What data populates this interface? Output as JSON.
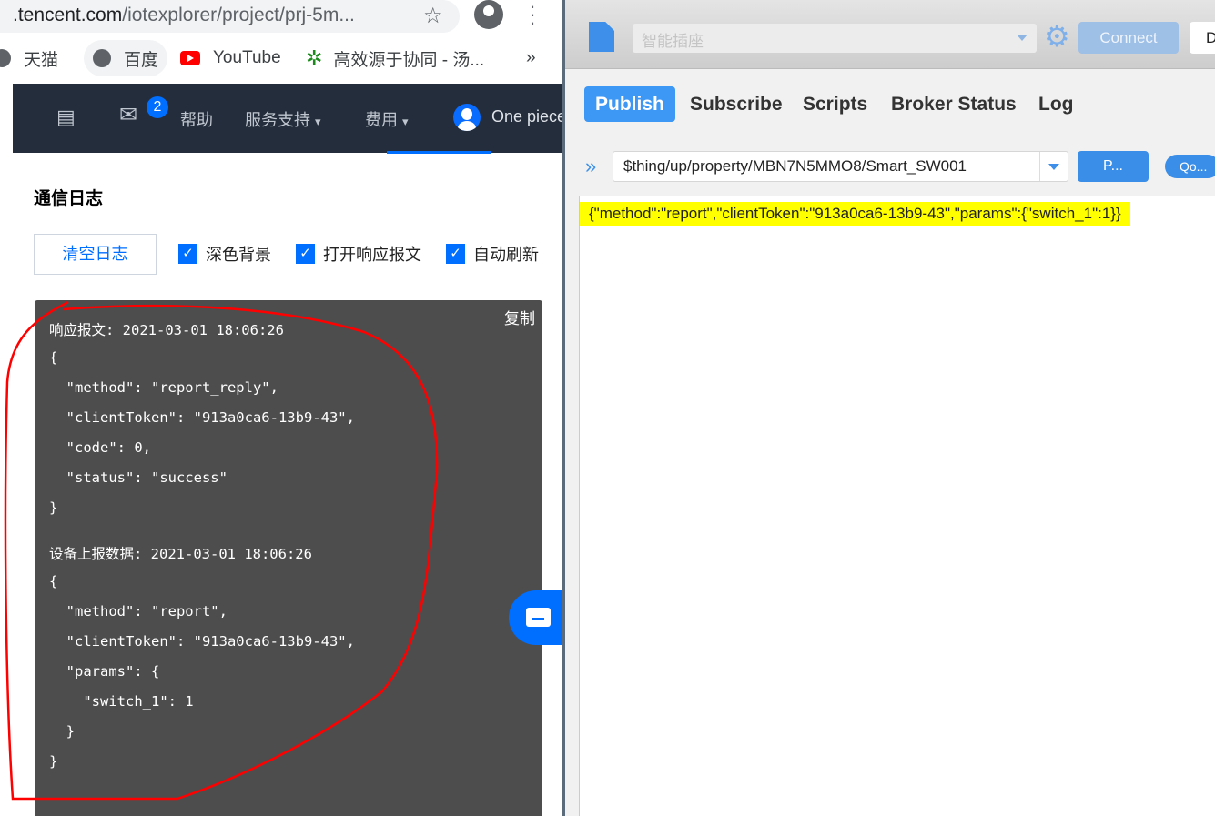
{
  "browser": {
    "url_host": ".tencent.com",
    "url_path": "/iotexplorer/project/prj-5m...",
    "bookmarks": [
      {
        "label": "天猫",
        "icon": "globe-icon"
      },
      {
        "label": "百度",
        "icon": "globe-icon"
      },
      {
        "label": "YouTube",
        "icon": "youtube-icon"
      },
      {
        "label": "高效源于协同 - 汤...",
        "icon": "gear-green-icon"
      }
    ],
    "more": "»"
  },
  "nav": {
    "badge": "2",
    "help": "帮助",
    "support": "服务支持",
    "fees": "费用",
    "user": "One piece",
    "caret": "⌄"
  },
  "log": {
    "title": "通信日志",
    "clear_button": "清空日志",
    "checkboxes": [
      {
        "label": "深色背景",
        "checked": true
      },
      {
        "label": "打开响应报文",
        "checked": true
      },
      {
        "label": "自动刷新",
        "checked": true
      }
    ],
    "copy": "复制",
    "lines": [
      "响应报文: 2021-03-01 18:06:26",
      "{",
      "  \"method\": \"report_reply\",",
      "  \"clientToken\": \"913a0ca6-13b9-43\",",
      "  \"code\": 0,",
      "  \"status\": \"success\"",
      "}",
      "设备上报数据: 2021-03-01 18:06:26",
      "{",
      "  \"method\": \"report\",",
      "  \"clientToken\": \"913a0ca6-13b9-43\",",
      "  \"params\": {",
      "    \"switch_1\": 1",
      "  }",
      "}"
    ]
  },
  "mqtt": {
    "profile": "智能插座",
    "connect": "Connect",
    "disconnect": "D",
    "tabs": [
      "Publish",
      "Subscribe",
      "Scripts",
      "Broker Status",
      "Log"
    ],
    "active_tab": "Publish",
    "topic": "$thing/up/property/MBN7N5MMO8/Smart_SW001",
    "publish_button": "P...",
    "qos_button": "Qo...",
    "payload": "{\"method\":\"report\",\"clientToken\":\"913a0ca6-13b9-43\",\"params\":{\"switch_1\":1}}"
  },
  "colors": {
    "accent": "#006eff",
    "mqtt_accent": "#3d97f5",
    "highlight": "#ffff00",
    "annotation": "#ff0000"
  }
}
